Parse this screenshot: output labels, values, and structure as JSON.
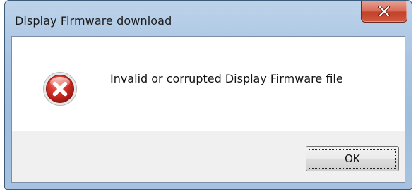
{
  "window": {
    "title": "Display Firmware download"
  },
  "dialog": {
    "icon": "error-icon",
    "message": "Invalid or corrupted Display Firmware file"
  },
  "buttons": {
    "ok_label": "OK",
    "close_icon": "close-icon"
  },
  "colors": {
    "titlebar": "#a9c4e2",
    "close_button": "#c2412a",
    "error_icon": "#c9201a",
    "content_bg": "#ffffff",
    "button_area_bg": "#f0f0f0"
  }
}
